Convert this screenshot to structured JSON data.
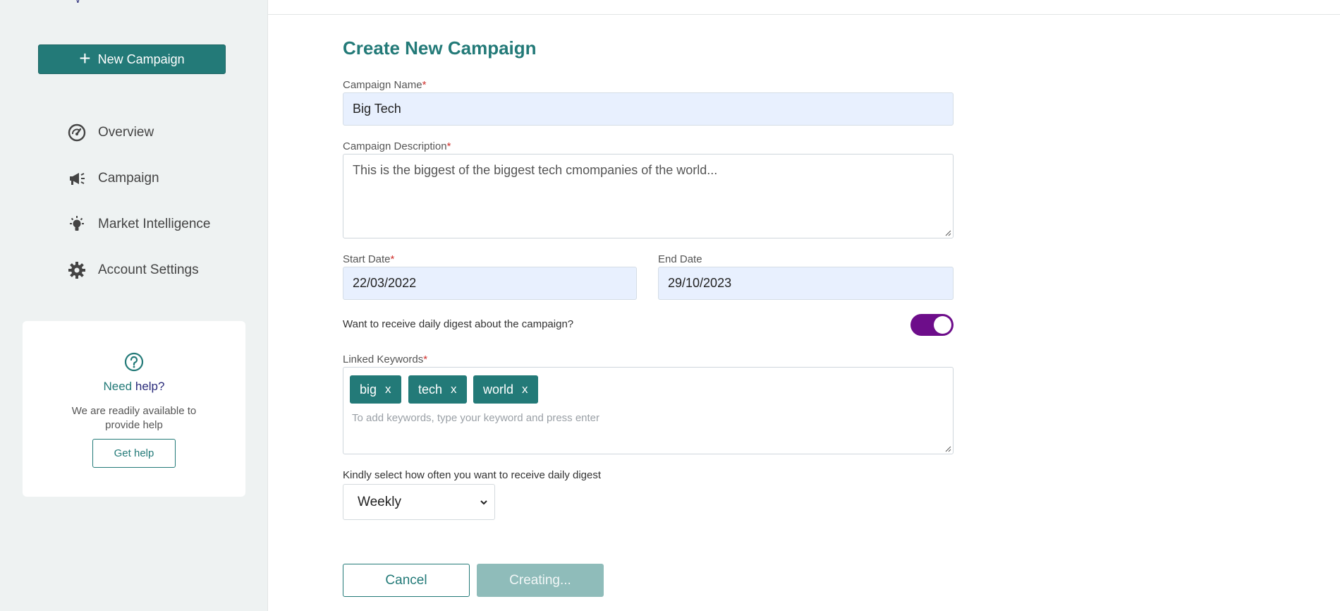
{
  "sidebar": {
    "new_campaign_label": "New Campaign",
    "nav": [
      {
        "label": "Overview",
        "icon": "gauge-icon"
      },
      {
        "label": "Campaign",
        "icon": "megaphone-icon"
      },
      {
        "label": "Market Intelligence",
        "icon": "lightbulb-icon"
      },
      {
        "label": "Account Settings",
        "icon": "gear-icon"
      }
    ],
    "help": {
      "title_part1": "Need",
      "title_part2": "help?",
      "description": "We are readily available to provide help",
      "button": "Get help"
    }
  },
  "form": {
    "title": "Create New Campaign",
    "campaign_name": {
      "label": "Campaign Name",
      "value": "Big Tech"
    },
    "campaign_description": {
      "label": "Campaign Description",
      "value": "This is the biggest of the biggest tech cmompanies of the world..."
    },
    "start_date": {
      "label": "Start Date",
      "value": "22/03/2022"
    },
    "end_date": {
      "label": "End Date",
      "value": "29/10/2023"
    },
    "digest_question": "Want to receive daily digest about the campaign?",
    "digest_enabled": true,
    "linked_keywords": {
      "label": "Linked Keywords",
      "keywords": [
        "big",
        "tech",
        "world"
      ],
      "remove_glyph": "x",
      "placeholder": "To add keywords, type your keyword and press enter"
    },
    "frequency": {
      "label": "Kindly select how often you want to receive daily digest",
      "selected": "Weekly"
    },
    "required_marker": "*",
    "cancel_label": "Cancel",
    "submit_label": "Creating..."
  },
  "colors": {
    "brand": "#237a78",
    "toggle_on": "#6d0d8a",
    "input_fill": "#e8f0fe",
    "submit_disabled": "#8fbcba"
  }
}
